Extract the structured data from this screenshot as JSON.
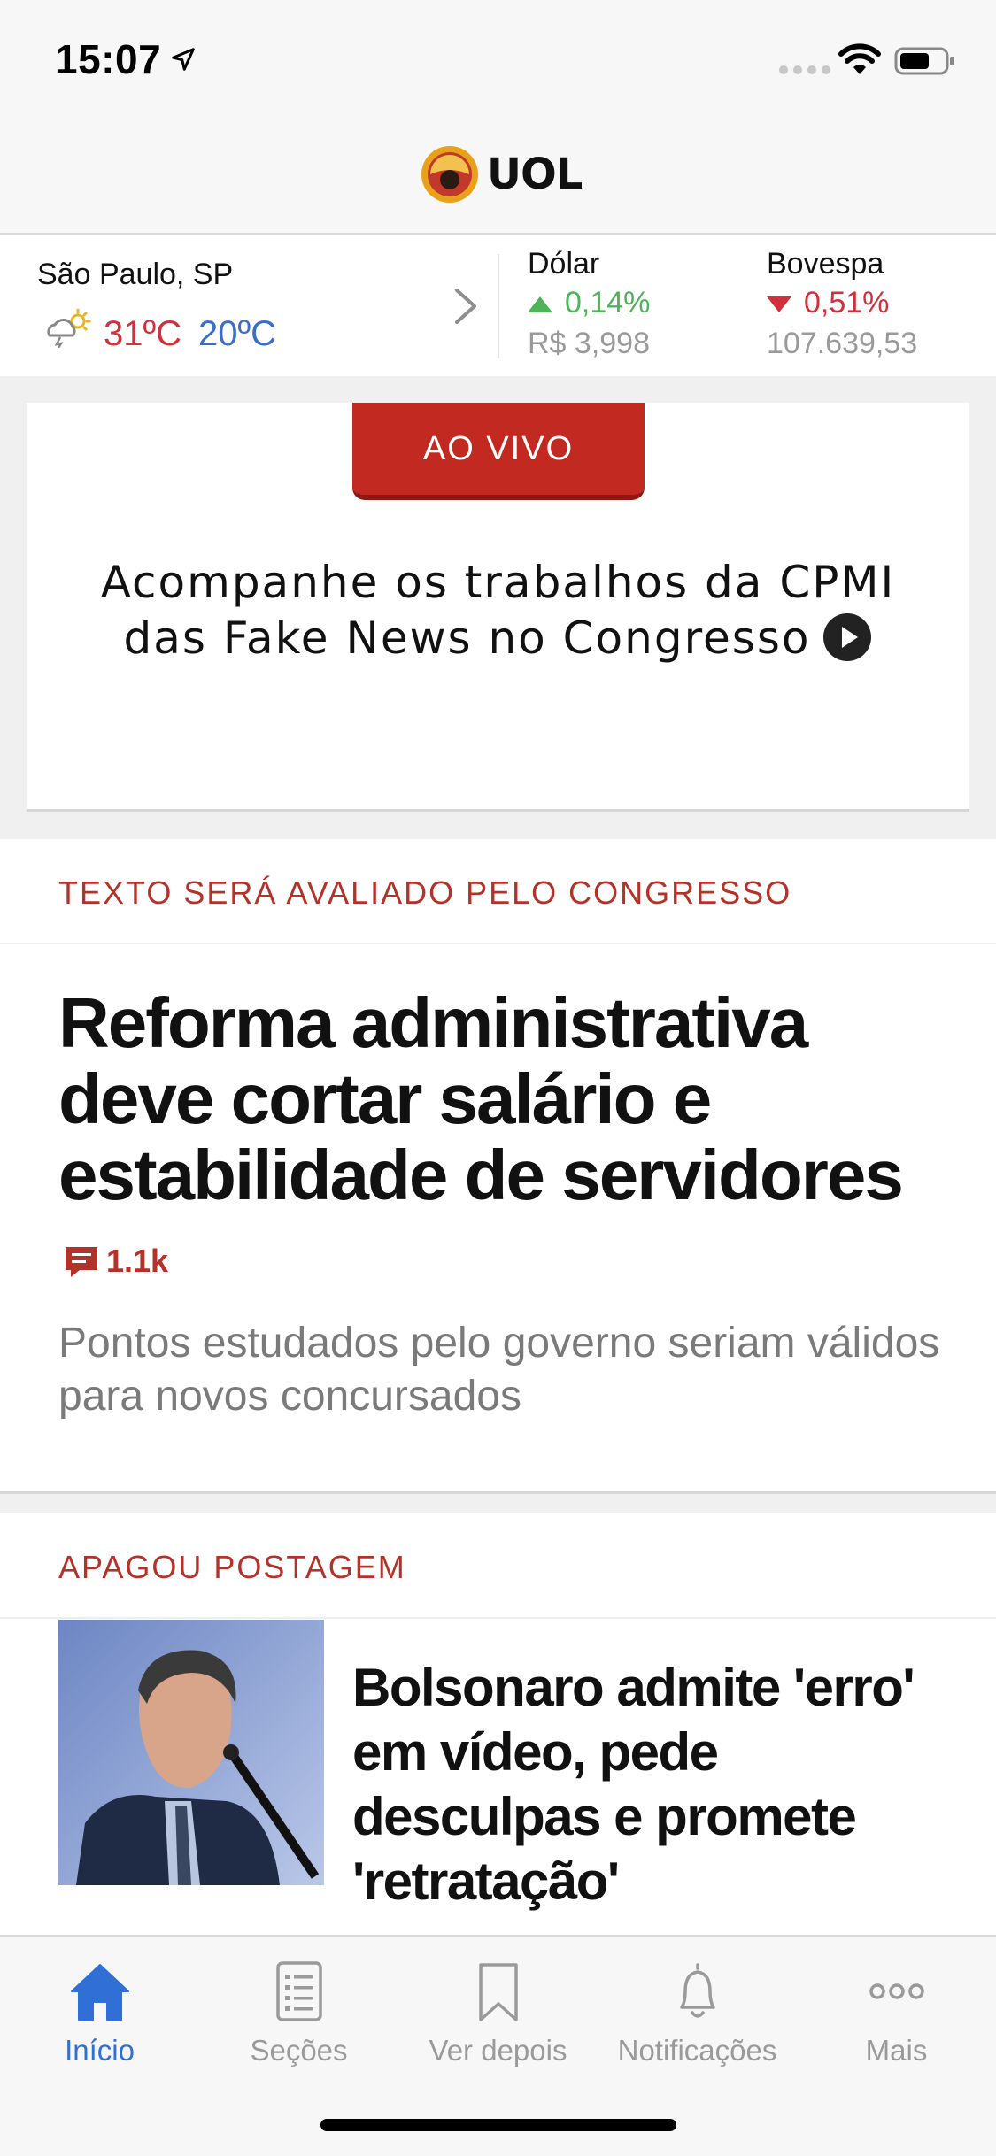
{
  "status_bar": {
    "time": "15:07"
  },
  "header": {
    "logo_text": "UOL"
  },
  "info_strip": {
    "city": "São Paulo, SP",
    "temp_max": "31ºC",
    "temp_min": "20ºC",
    "markets": [
      {
        "label": "Dólar",
        "change": "0,14%",
        "direction": "up",
        "value": "R$  3,998"
      },
      {
        "label": "Bovespa",
        "change": "0,51%",
        "direction": "down",
        "value": "107.639,53"
      }
    ]
  },
  "live": {
    "button_label": "AO VIVO",
    "text": "Acompanhe os trabalhos da CPMI das Fake News no Congresso"
  },
  "stories": [
    {
      "kicker": "TEXTO SERÁ AVALIADO PELO CONGRESSO",
      "headline": "Reforma administrativa deve cortar salário e estabilidade de servidores",
      "comments": "1.1k",
      "subtitle": "Pontos estudados pelo governo seriam válidos para novos concursados"
    },
    {
      "kicker": "APAGOU POSTAGEM",
      "headline": "Bolsonaro admite 'erro' em vídeo, pede desculpas e promete 'retratação'"
    }
  ],
  "tabbar": {
    "tabs": [
      {
        "label": "Início",
        "icon": "home-icon",
        "active": true
      },
      {
        "label": "Seções",
        "icon": "list-icon"
      },
      {
        "label": "Ver depois",
        "icon": "bookmark-icon"
      },
      {
        "label": "Notificações",
        "icon": "bell-icon"
      },
      {
        "label": "Mais",
        "icon": "more-icon"
      }
    ]
  },
  "colors": {
    "accent_red": "#c22a21",
    "kicker_red": "#b3322a",
    "active_blue": "#2f6fd6",
    "up_green": "#4fb35a",
    "down_red": "#d0313b"
  }
}
